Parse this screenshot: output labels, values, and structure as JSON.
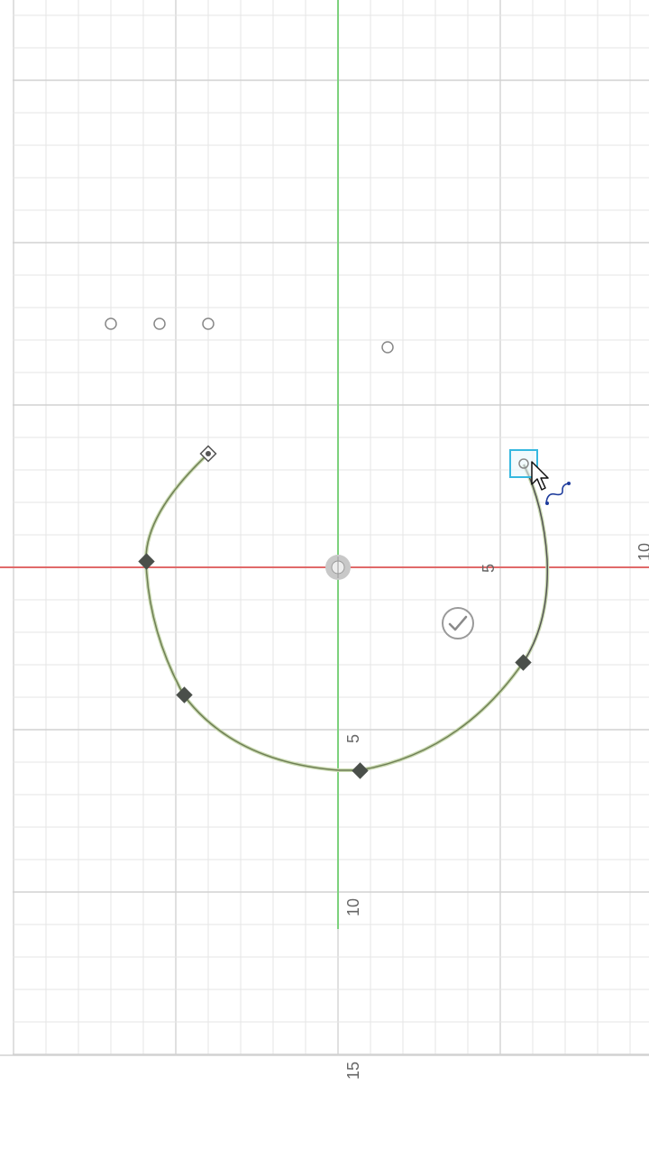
{
  "app": {
    "view": "sketch-canvas"
  },
  "axis_labels": {
    "x_5": "5",
    "x_10": "10",
    "y_5": "5",
    "y_10": "10",
    "y_15": "15"
  },
  "colors": {
    "grid_minor": "#e6e6e6",
    "grid_major": "#d2d2d2",
    "axis_x": "#e06a6a",
    "axis_y": "#7dd17d",
    "curve_green": "#8aa86a",
    "curve_dark": "#555555",
    "point_fill": "#4a4f4a",
    "selection_box": "#36b8e0",
    "cursor_curve": "#1e3c9c"
  },
  "icons": {
    "origin": "origin-icon",
    "check": "check-icon",
    "cursor": "arrow-cursor-icon",
    "fit_point_cursor": "spline-cursor-icon"
  }
}
